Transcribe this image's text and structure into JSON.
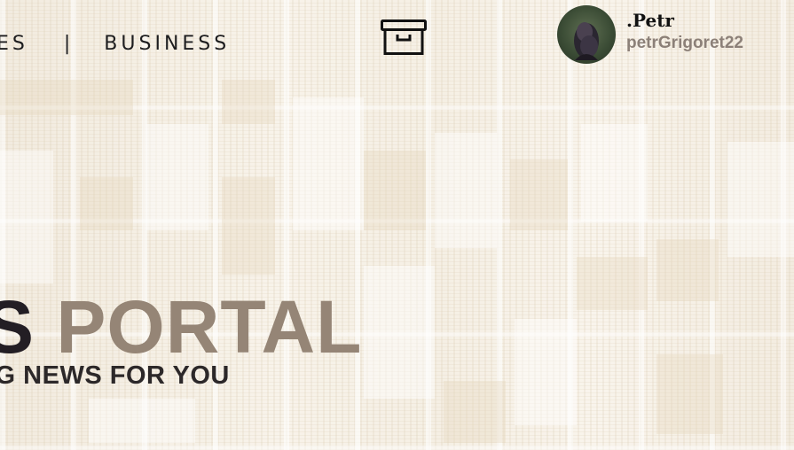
{
  "nav": {
    "items": [
      {
        "label": "ES"
      },
      {
        "label": "BUSINESS"
      }
    ],
    "separator": "|"
  },
  "archive": {
    "icon": "archive-box-icon"
  },
  "profile": {
    "name": ".Petr",
    "handle": "petrGrigoret22",
    "avatar_icon": "user-avatar"
  },
  "hero": {
    "title_dark": "S",
    "title_light": "PORTAL",
    "subtitle": "IG NEWS FOR YOU"
  },
  "colors": {
    "title_dark": "#231e24",
    "title_light": "#958576",
    "handle": "#8c8078",
    "background": "#f6f1e8"
  }
}
